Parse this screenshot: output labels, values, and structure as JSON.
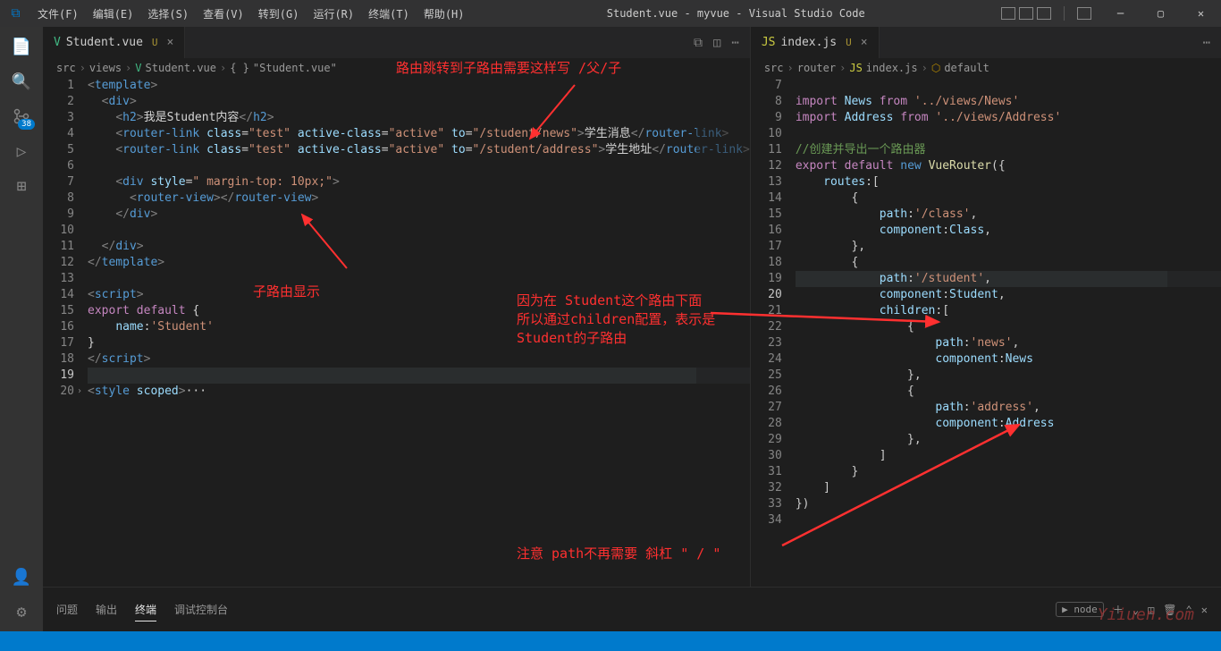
{
  "title": "Student.vue - myvue - Visual Studio Code",
  "menu": [
    "文件(F)",
    "编辑(E)",
    "选择(S)",
    "查看(V)",
    "转到(G)",
    "运行(R)",
    "终端(T)",
    "帮助(H)"
  ],
  "activity_badge": "38",
  "left_tab": {
    "name": "Student.vue",
    "modified": "U"
  },
  "right_tab": {
    "name": "index.js",
    "modified": "U"
  },
  "left_breadcrumb": [
    "src",
    "views",
    "Student.vue",
    "\"Student.vue\""
  ],
  "right_breadcrumb": [
    "src",
    "router",
    "index.js",
    "default"
  ],
  "left_lines": [
    "1",
    "2",
    "3",
    "4",
    "5",
    "6",
    "7",
    "8",
    "9",
    "10",
    "11",
    "12",
    "13",
    "14",
    "15",
    "16",
    "17",
    "18",
    "19",
    "20"
  ],
  "right_lines": [
    "7",
    "8",
    "9",
    "10",
    "11",
    "12",
    "13",
    "14",
    "15",
    "16",
    "17",
    "18",
    "19",
    "20",
    "21",
    "22",
    "23",
    "24",
    "25",
    "26",
    "27",
    "28",
    "29",
    "30",
    "31",
    "32",
    "33",
    "34"
  ],
  "left_code": {
    "l1": "<template>",
    "l3": "我是Student内容",
    "l4a": "学生消息",
    "l4b": "/student/news",
    "l5a": "学生地址",
    "l5b": "/student/address",
    "l7": " margin-top: 10px;",
    "l15": "export default {",
    "l16": "'Student'",
    "l20": "style scoped"
  },
  "right_code": {
    "l8": "'../views/News'",
    "l9": "'../views/Address'",
    "l11": "//创建并导出一个路由器",
    "l12": "VueRouter",
    "l13": "routes:[",
    "l16": "'/class'",
    "l17": "component:Class,",
    "l20": "'/student'",
    "l21": "component:Student,",
    "l22": "children:[",
    "l24": "'news'",
    "l25": "component:News",
    "l28": "'address'",
    "l29": "component:Address"
  },
  "annotations": {
    "a1": "路由跳转到子路由需要这样写 /父/子",
    "a2": "子路由显示",
    "a3a": "因为在 Student这个路由下面",
    "a3b": "所以通过children配置，表示是",
    "a3c": "Student的子路由",
    "a4": "注意 path不再需要 斜杠 \" / \""
  },
  "panel": {
    "tabs": [
      "问题",
      "输出",
      "终端",
      "调试控制台"
    ],
    "active": 2,
    "node": "node"
  },
  "watermark": "Yiiuen.com"
}
